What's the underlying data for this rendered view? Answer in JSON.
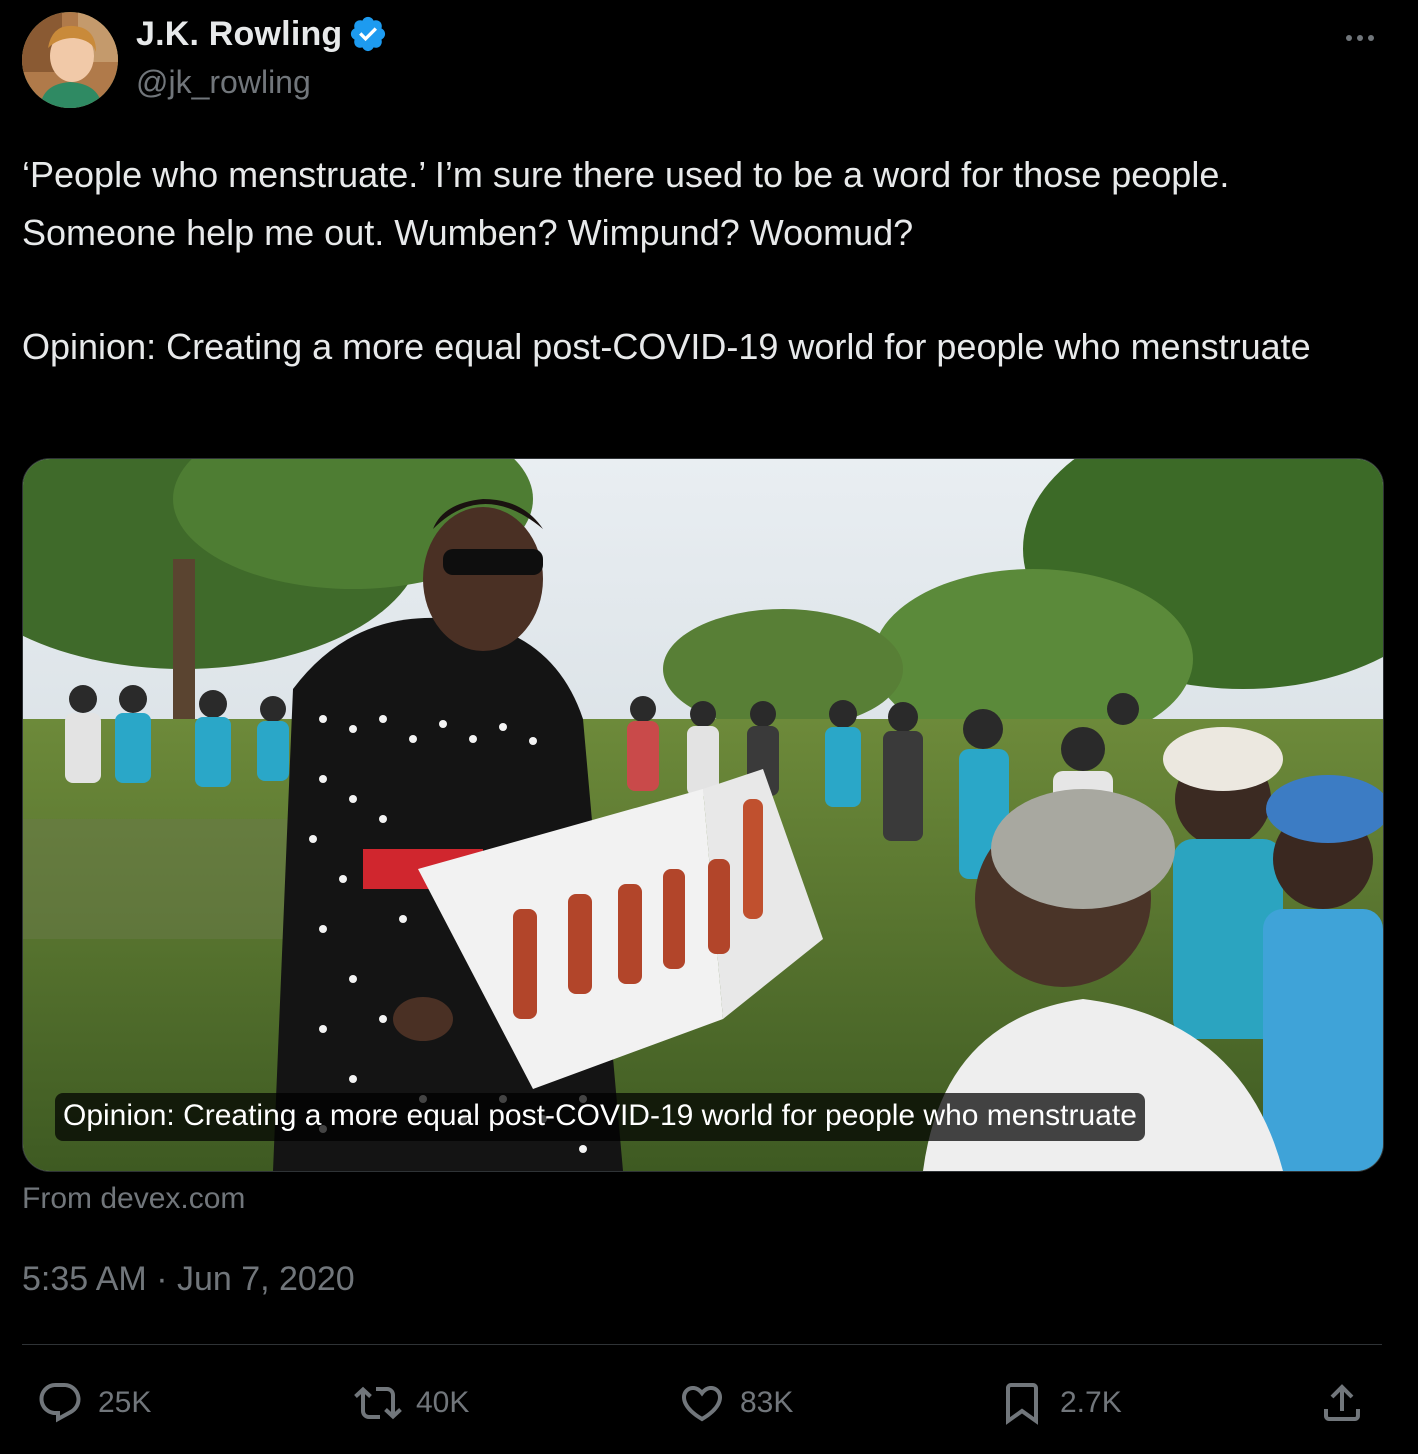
{
  "author": {
    "display_name": "J.K. Rowling",
    "handle": "@jk_rowling",
    "verified": true,
    "verified_color": "#1d9bf0"
  },
  "tweet": {
    "text_line1": "‘People who menstruate.’ I’m sure there used to be a word for those people. Someone help me out. Wumben? Wimpund? Woomud?",
    "text_line2": "Opinion: Creating a more equal post-COVID-19 world for people who menstruate",
    "timestamp": "5:35 AM · Jun 7, 2020"
  },
  "card": {
    "caption": "Opinion: Creating a more equal post-COVID-19 world for people who menstruate",
    "source": "From devex.com",
    "image_icon": "photo-of-woman-presenting-chart-to-group"
  },
  "actions": {
    "replies": {
      "icon": "reply-icon",
      "count": "25K"
    },
    "reposts": {
      "icon": "repost-icon",
      "count": "40K"
    },
    "likes": {
      "icon": "heart-icon",
      "count": "83K"
    },
    "bookmarks": {
      "icon": "bookmark-icon",
      "count": "2.7K"
    },
    "share": {
      "icon": "share-icon"
    }
  },
  "colors": {
    "background": "#000000",
    "text_primary": "#e7e9ea",
    "text_secondary": "#71767b",
    "border": "#2f3336"
  }
}
